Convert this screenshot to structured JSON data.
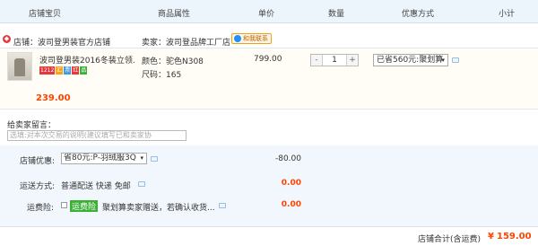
{
  "header": {
    "shop_item": "店铺宝贝",
    "attributes": "商品属性",
    "unit_price": "单价",
    "quantity": "数量",
    "promo": "优惠方式",
    "subtotal": "小计"
  },
  "shop": {
    "label": "店铺：波司登男装官方店铺",
    "seller": "卖家：波司登品牌工厂店",
    "chat_badge": "和我联系"
  },
  "item": {
    "title": "波司登男装2016冬装立领...",
    "tags": [
      "1212",
      "汇",
      "票",
      "红",
      "品"
    ],
    "color_attr": "颜色：驼色N308",
    "size_attr": "尺码：165",
    "price": "799.00",
    "qty_minus": "-",
    "qty_value": "1",
    "qty_plus": "+",
    "promo_select": "已省560元:聚划算",
    "subtotal": "239.00"
  },
  "remark": {
    "label": "给卖家留言：",
    "placeholder": "选填:对本次交易的说明(建议填写已和卖家协"
  },
  "shop_discount": {
    "label": "店铺优惠:",
    "select": "省80元:P-羽绒服3Q",
    "amount": "-80.00"
  },
  "shipping": {
    "label": "运送方式:",
    "value": "普通配送 快递 免邮",
    "amount": "0.00"
  },
  "insurance": {
    "label": "运费险:",
    "tag": "运费险",
    "text": "聚划算卖家赠送，若确认收货...",
    "amount": "0.00"
  },
  "total": {
    "label": "店铺合计(含运费)",
    "currency": "¥",
    "value": "159.00"
  },
  "colors": {
    "accent": "#ff4400",
    "header_bg": "#ecf5fc",
    "panel_bg": "#f2f7fd"
  }
}
